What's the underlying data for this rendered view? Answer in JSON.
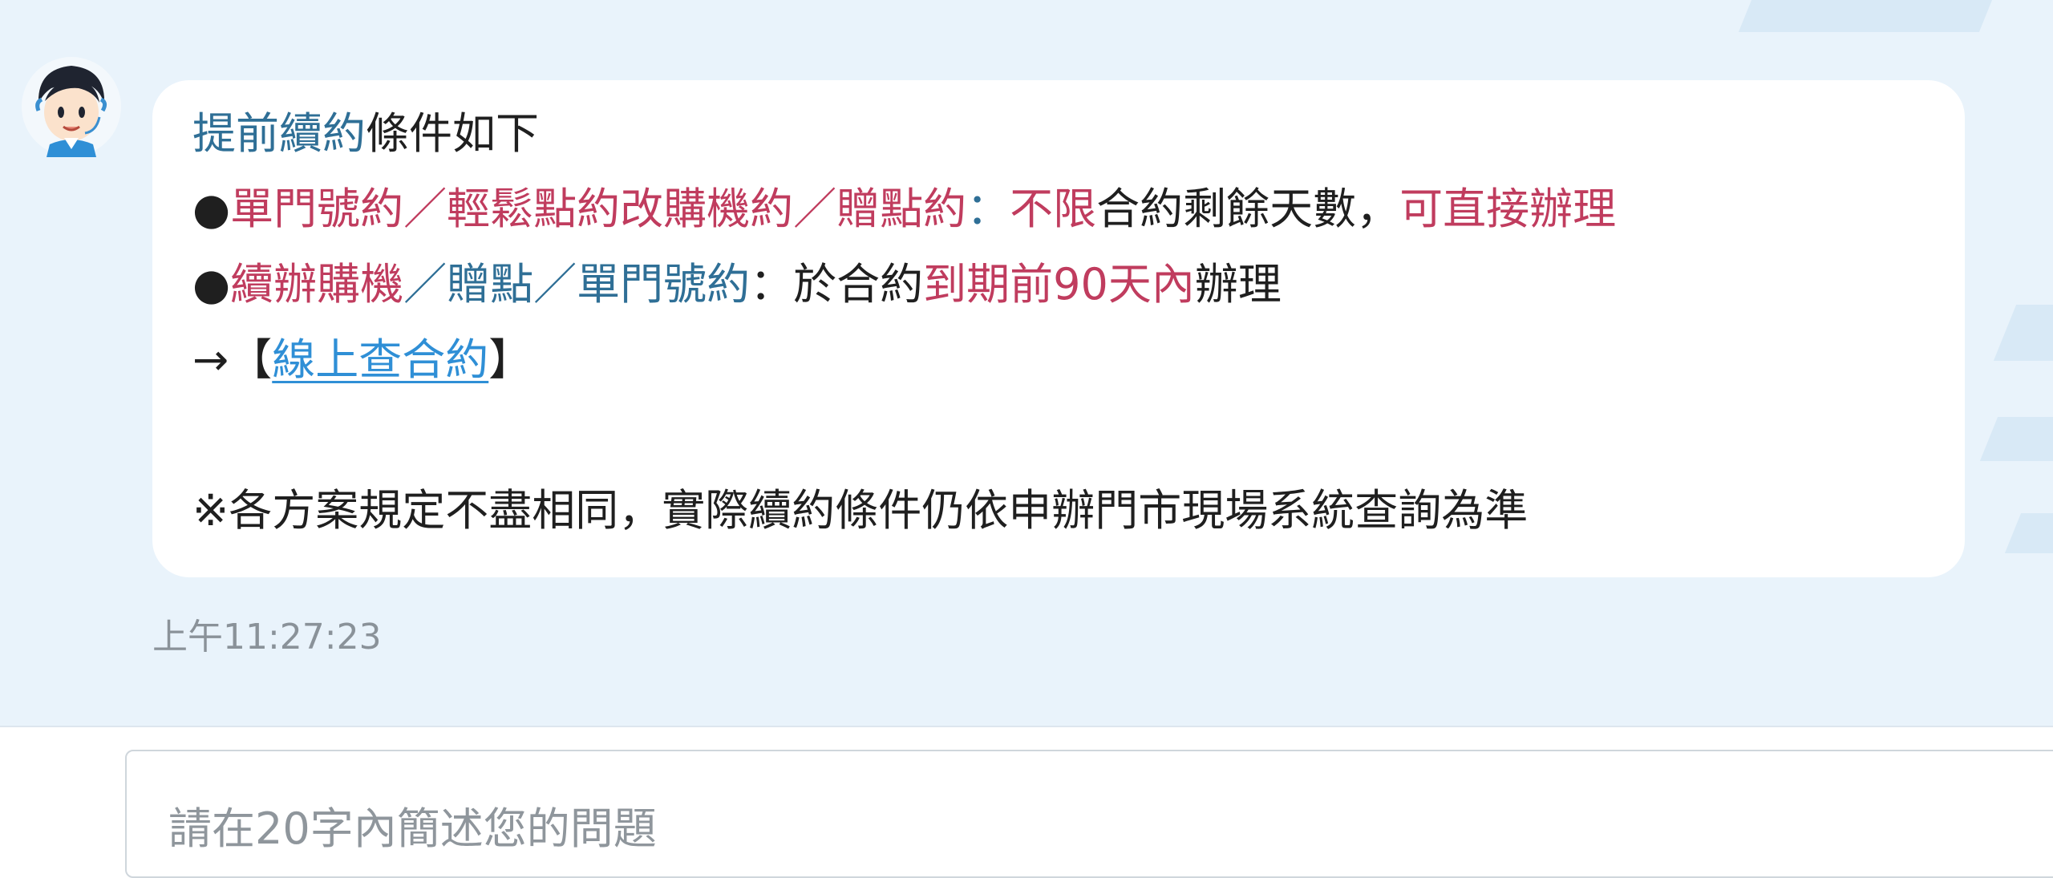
{
  "message": {
    "line1": {
      "highlight": "提前續約",
      "rest": "條件如下"
    },
    "line2": {
      "bullet": "●",
      "plans": "單門號約／輕鬆點約改購機約／贈點約",
      "colon": "：",
      "condition": "不限",
      "middle": "合約剩餘天數，",
      "action": "可直接辦理"
    },
    "line3": {
      "bullet": "●",
      "plans_red": "續辦購機",
      "plans_blue": "／贈點／單門號約",
      "colon_text": "：於合約",
      "deadline": "到期前90天內",
      "end": "辦理"
    },
    "line4": {
      "arrow": "→【",
      "link_text": "線上查合約",
      "close": "】"
    },
    "note": "※各方案規定不盡相同，實際續約條件仍依申辦門市現場系統查詢為準"
  },
  "timestamp": "上午11:27:23",
  "input": {
    "placeholder": "請在20字內簡述您的問題"
  },
  "avatar": {
    "icon": "customer-service-agent-avatar"
  },
  "colors": {
    "chat_background": "#e9f3fb",
    "bubble": "#ffffff",
    "blue_text": "#2f6f96",
    "red_text": "#c03c5e",
    "link": "#2f8fd6"
  }
}
